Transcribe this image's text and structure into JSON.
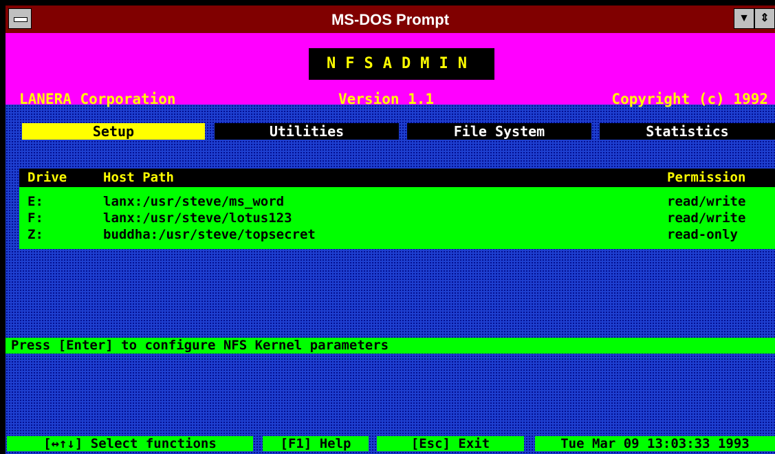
{
  "window": {
    "title": "MS-DOS Prompt"
  },
  "icons": {
    "system_menu": "system-menu-icon",
    "minimize": "minimize-icon",
    "restore": "restore-icon"
  },
  "header": {
    "app_name": "NFSADMIN",
    "company": "LANERA Corporation",
    "version": "Version 1.1",
    "copyright": "Copyright (c) 1992"
  },
  "menu": [
    {
      "label": "Setup",
      "active": true
    },
    {
      "label": "Utilities",
      "active": false
    },
    {
      "label": "File System",
      "active": false
    },
    {
      "label": "Statistics",
      "active": false
    }
  ],
  "table": {
    "columns": {
      "drive": "Drive",
      "path": "Host Path",
      "permission": "Permission"
    },
    "rows": [
      {
        "drive": "E:",
        "path": "lanx:/usr/steve/ms_word",
        "permission": "read/write"
      },
      {
        "drive": "F:",
        "path": "lanx:/usr/steve/lotus123",
        "permission": "read/write"
      },
      {
        "drive": "Z:",
        "path": "buddha:/usr/steve/topsecret",
        "permission": "read-only"
      }
    ]
  },
  "status": "Press [Enter] to configure NFS Kernel parameters",
  "footer": {
    "select": "[↔↑↓] Select functions",
    "help": "[F1] Help",
    "exit": "[Esc] Exit",
    "datetime": "Tue Mar 09 13:03:33 1993"
  },
  "colors": {
    "title_bar": "#800000",
    "header_bg": "#ff00ff",
    "screen_bg": "#1e3fd0",
    "highlight_green": "#00ff00",
    "accent_yellow": "#ffff00"
  }
}
